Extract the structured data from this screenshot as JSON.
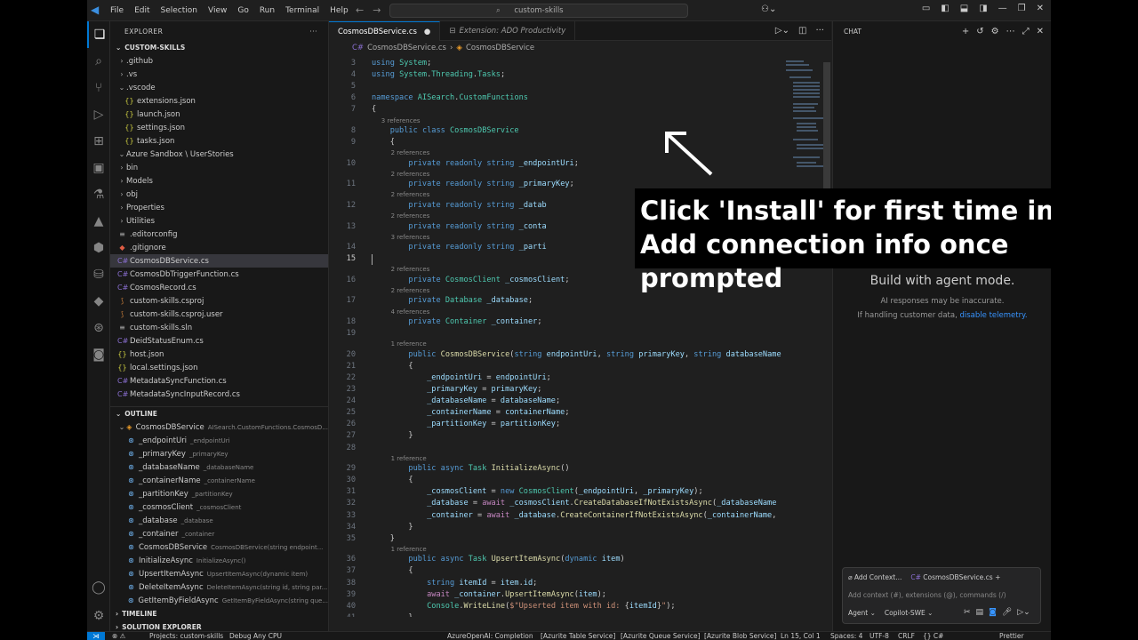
{
  "titlebar": {
    "menus": [
      "File",
      "Edit",
      "Selection",
      "View",
      "Go",
      "Run",
      "Terminal",
      "Help"
    ],
    "search": "custom-skills"
  },
  "explorer": {
    "header": "EXPLORER",
    "project": "CUSTOM-SKILLS",
    "items": [
      {
        "indent": 1,
        "chev": "›",
        "icon": "",
        "label": ".github"
      },
      {
        "indent": 1,
        "chev": "›",
        "icon": "",
        "label": ".vs"
      },
      {
        "indent": 1,
        "chev": "⌄",
        "icon": "",
        "label": ".vscode"
      },
      {
        "indent": 2,
        "chev": "",
        "icon": "{}",
        "label": "extensions.json"
      },
      {
        "indent": 2,
        "chev": "",
        "icon": "{}",
        "label": "launch.json"
      },
      {
        "indent": 2,
        "chev": "",
        "icon": "{}",
        "label": "settings.json"
      },
      {
        "indent": 2,
        "chev": "",
        "icon": "{}",
        "label": "tasks.json"
      },
      {
        "indent": 1,
        "chev": "⌄",
        "icon": "",
        "label": "Azure Sandbox \\ UserStories"
      },
      {
        "indent": 1,
        "chev": "›",
        "icon": "",
        "label": "bin"
      },
      {
        "indent": 1,
        "chev": "›",
        "icon": "",
        "label": "Models"
      },
      {
        "indent": 1,
        "chev": "›",
        "icon": "",
        "label": "obj"
      },
      {
        "indent": 1,
        "chev": "›",
        "icon": "",
        "label": "Properties"
      },
      {
        "indent": 1,
        "chev": "›",
        "icon": "",
        "label": "Utilities"
      },
      {
        "indent": 1,
        "chev": "",
        "icon": "≡",
        "label": ".editorconfig"
      },
      {
        "indent": 1,
        "chev": "",
        "icon": "◆",
        "label": ".gitignore"
      },
      {
        "indent": 1,
        "chev": "",
        "icon": "C#",
        "label": "CosmosDBService.cs",
        "selected": true
      },
      {
        "indent": 1,
        "chev": "",
        "icon": "C#",
        "label": "CosmosDbTriggerFunction.cs"
      },
      {
        "indent": 1,
        "chev": "",
        "icon": "C#",
        "label": "CosmosRecord.cs"
      },
      {
        "indent": 1,
        "chev": "",
        "icon": "⟆",
        "label": "custom-skills.csproj"
      },
      {
        "indent": 1,
        "chev": "",
        "icon": "⟆",
        "label": "custom-skills.csproj.user"
      },
      {
        "indent": 1,
        "chev": "",
        "icon": "≡",
        "label": "custom-skills.sln"
      },
      {
        "indent": 1,
        "chev": "",
        "icon": "C#",
        "label": "DeidStatusEnum.cs"
      },
      {
        "indent": 1,
        "chev": "",
        "icon": "{}",
        "label": "host.json"
      },
      {
        "indent": 1,
        "chev": "",
        "icon": "{}",
        "label": "local.settings.json"
      },
      {
        "indent": 1,
        "chev": "",
        "icon": "C#",
        "label": "MetadataSyncFunction.cs"
      },
      {
        "indent": 1,
        "chev": "",
        "icon": "C#",
        "label": "MetadataSyncInputRecord.cs"
      }
    ]
  },
  "outline": {
    "header": "OUTLINE",
    "items": [
      {
        "indent": 1,
        "chev": "⌄",
        "label": "CosmosDBService",
        "sub": "AISearch.CustomFunctions.CosmosD..."
      },
      {
        "indent": 2,
        "label": "_endpointUri",
        "sub": "_endpointUri"
      },
      {
        "indent": 2,
        "label": "_primaryKey",
        "sub": "_primaryKey"
      },
      {
        "indent": 2,
        "label": "_databaseName",
        "sub": "_databaseName"
      },
      {
        "indent": 2,
        "label": "_containerName",
        "sub": "_containerName"
      },
      {
        "indent": 2,
        "label": "_partitionKey",
        "sub": "_partitionKey"
      },
      {
        "indent": 2,
        "label": "_cosmosClient",
        "sub": "_cosmosClient"
      },
      {
        "indent": 2,
        "label": "_database",
        "sub": "_database"
      },
      {
        "indent": 2,
        "label": "_container",
        "sub": "_container"
      },
      {
        "indent": 2,
        "label": "CosmosDBService",
        "sub": "CosmosDBService(string endpoint..."
      },
      {
        "indent": 2,
        "label": "InitializeAsync",
        "sub": "InitializeAsync()"
      },
      {
        "indent": 2,
        "label": "UpsertItemAsync",
        "sub": "UpsertItemAsync(dynamic item)"
      },
      {
        "indent": 2,
        "label": "DeleteItemAsync",
        "sub": "DeleteItemAsync(string id, string par..."
      },
      {
        "indent": 2,
        "label": "GetItemByFieldAsync",
        "sub": "GetItemByFieldAsync(string que..."
      }
    ],
    "timeline": "TIMELINE",
    "solution": "SOLUTION EXPLORER"
  },
  "tabs": [
    {
      "label": "CosmosDBService.cs",
      "active": true,
      "dirty": "●"
    },
    {
      "label": "Extension: ADO Productivity",
      "active": false,
      "dirty": ""
    }
  ],
  "breadcrumb": [
    "CosmosDBService.cs",
    "›",
    "CosmosDBService"
  ],
  "code": [
    {
      "n": "3",
      "h": "<span class='kw'>using</span> <span class='ty'>System</span>;"
    },
    {
      "n": "4",
      "h": "<span class='kw'>using</span> <span class='ty'>System</span>.<span class='ty'>Threading</span>.<span class='ty'>Tasks</span>;"
    },
    {
      "n": "5",
      "h": ""
    },
    {
      "n": "6",
      "h": "<span class='kw'>namespace</span> <span class='ty'>AISearch</span>.<span class='ty'>CustomFunctions</span>"
    },
    {
      "n": "7",
      "h": "{"
    },
    {
      "lens": "3 references",
      "lind": 2
    },
    {
      "n": "8",
      "h": "    <span class='kw'>public</span> <span class='kw'>class</span> <span class='ty'>CosmosDBService</span>"
    },
    {
      "n": "9",
      "h": "    {"
    },
    {
      "lens": "2 references",
      "lind": 4
    },
    {
      "n": "10",
      "h": "        <span class='kw'>private</span> <span class='kw'>readonly</span> <span class='kw'>string</span> <span class='vr'>_endpointUri</span>;"
    },
    {
      "lens": "2 references",
      "lind": 4
    },
    {
      "n": "11",
      "h": "        <span class='kw'>private</span> <span class='kw'>readonly</span> <span class='kw'>string</span> <span class='vr'>_primaryKey</span>;"
    },
    {
      "lens": "2 references",
      "lind": 4
    },
    {
      "n": "12",
      "h": "        <span class='kw'>private</span> <span class='kw'>readonly</span> <span class='kw'>string</span> <span class='vr'>_datab</span>"
    },
    {
      "lens": "2 references",
      "lind": 4
    },
    {
      "n": "13",
      "h": "        <span class='kw'>private</span> <span class='kw'>readonly</span> <span class='kw'>string</span> <span class='vr'>_conta</span>"
    },
    {
      "lens": "3 references",
      "lind": 4
    },
    {
      "n": "14",
      "h": "        <span class='kw'>private</span> <span class='kw'>readonly</span> <span class='kw'>string</span> <span class='vr'>_parti</span>"
    },
    {
      "n": "15",
      "h": "",
      "cur": true
    },
    {
      "lens": "2 references",
      "lind": 4
    },
    {
      "n": "16",
      "h": "        <span class='kw'>private</span> <span class='ty'>CosmosClient</span> <span class='vr'>_cosmosClient</span>;"
    },
    {
      "lens": "2 references",
      "lind": 4
    },
    {
      "n": "17",
      "h": "        <span class='kw'>private</span> <span class='ty'>Database</span> <span class='vr'>_database</span>;"
    },
    {
      "lens": "4 references",
      "lind": 4
    },
    {
      "n": "18",
      "h": "        <span class='kw'>private</span> <span class='ty'>Container</span> <span class='vr'>_container</span>;"
    },
    {
      "n": "19",
      "h": ""
    },
    {
      "lens": "1 reference",
      "lind": 4
    },
    {
      "n": "20",
      "h": "        <span class='kw'>public</span> <span class='fn'>CosmosDBService</span>(<span class='kw'>string</span> <span class='vr'>endpointUri</span>, <span class='kw'>string</span> <span class='vr'>primaryKey</span>, <span class='kw'>string</span> <span class='vr'>databaseName</span>"
    },
    {
      "n": "21",
      "h": "        {"
    },
    {
      "n": "22",
      "h": "            <span class='vr'>_endpointUri</span> = <span class='vr'>endpointUri</span>;"
    },
    {
      "n": "23",
      "h": "            <span class='vr'>_primaryKey</span> = <span class='vr'>primaryKey</span>;"
    },
    {
      "n": "24",
      "h": "            <span class='vr'>_databaseName</span> = <span class='vr'>databaseName</span>;"
    },
    {
      "n": "25",
      "h": "            <span class='vr'>_containerName</span> = <span class='vr'>containerName</span>;"
    },
    {
      "n": "26",
      "h": "            <span class='vr'>_partitionKey</span> = <span class='vr'>partitionKey</span>;"
    },
    {
      "n": "27",
      "h": "        }"
    },
    {
      "n": "28",
      "h": ""
    },
    {
      "lens": "1 reference",
      "lind": 4
    },
    {
      "n": "29",
      "h": "        <span class='kw'>public</span> <span class='kw'>async</span> <span class='ty'>Task</span> <span class='fn'>InitializeAsync</span>()"
    },
    {
      "n": "30",
      "h": "        {"
    },
    {
      "n": "31",
      "h": "            <span class='vr'>_cosmosClient</span> = <span class='kw'>new</span> <span class='ty'>CosmosClient</span>(<span class='vr'>_endpointUri</span>, <span class='vr'>_primaryKey</span>);"
    },
    {
      "n": "32",
      "h": "            <span class='vr'>_database</span> = <span class='ctl'>await</span> <span class='vr'>_cosmosClient</span>.<span class='fn'>CreateDatabaseIfNotExistsAsync</span>(<span class='vr'>_databaseName</span>"
    },
    {
      "n": "33",
      "h": "            <span class='vr'>_container</span> = <span class='ctl'>await</span> <span class='vr'>_database</span>.<span class='fn'>CreateContainerIfNotExistsAsync</span>(<span class='vr'>_containerName</span>,"
    },
    {
      "n": "34",
      "h": "        }"
    },
    {
      "n": "35",
      "h": "    }"
    },
    {
      "lens": "1 reference",
      "lind": 4
    },
    {
      "n": "36",
      "h": "        <span class='kw'>public</span> <span class='kw'>async</span> <span class='ty'>Task</span> <span class='fn'>UpsertItemAsync</span>(<span class='kw'>dynamic</span> <span class='vr'>item</span>)"
    },
    {
      "n": "37",
      "h": "        {"
    },
    {
      "n": "38",
      "h": "            <span class='kw'>string</span> <span class='vr'>itemId</span> = <span class='vr'>item</span>.<span class='vr'>id</span>;"
    },
    {
      "n": "39",
      "h": "            <span class='ctl'>await</span> <span class='vr'>_container</span>.<span class='fn'>UpsertItemAsync</span>(<span class='vr'>item</span>);"
    },
    {
      "n": "40",
      "h": "            <span class='ty'>Console</span>.<span class='fn'>WriteLine</span>(<span class='str'>$\"Upserted item with id: </span>{<span class='vr'>itemId</span>}<span class='str'>\"</span>);"
    },
    {
      "n": "41",
      "h": "        }"
    },
    {
      "n": "42",
      "h": ""
    }
  ],
  "chat": {
    "header": "CHAT",
    "title": "Build with agent mode.",
    "disclaimer": "AI responses may be inaccurate.",
    "telemetry_prefix": "If handling customer data,",
    "telemetry_link": "disable telemetry.",
    "add_context": "Add Context...",
    "context_file": "CosmosDBService.cs",
    "placeholder": "Add context (#), extensions (@), commands (/)",
    "mode": "Agent ⌄",
    "model": "Copilot-SWE ⌄"
  },
  "overlay": {
    "line1": "Click 'Install' for first time install",
    "line2": "Add connection info once prompted"
  },
  "status": {
    "project": "Projects: custom-skills",
    "config": "Debug Any CPU",
    "services": [
      "AzureOpenAI: Completion",
      "[Azurite Table Service]",
      "[Azurite Queue Service]",
      "[Azurite Blob Service]"
    ],
    "position": "Ln 15, Col 1",
    "spaces": "Spaces: 4",
    "encoding": "UTF-8",
    "eol": "CRLF",
    "lang": "{} C#",
    "prettier": "Prettier"
  },
  "colors": {
    "accent": "#0078d4",
    "link": "#3794ff"
  }
}
